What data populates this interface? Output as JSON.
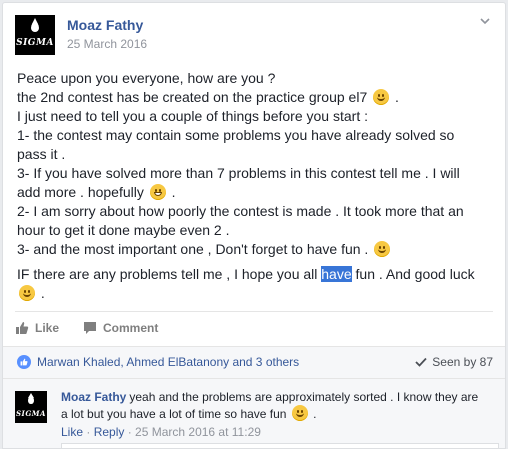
{
  "post": {
    "author": "Moaz Fathy",
    "date": "25 March 2016",
    "avatar_text": "SIGMA",
    "lines": [
      "Peace upon you everyone, how are you ?",
      "the 2nd contest has be created on the practice group el7",
      "I just need to tell you a couple of things before you start :",
      "1- the contest may contain some problems you have already solved so",
      "pass it .",
      "3- If you have solved more than 7 problems in this contest tell me . I will",
      "add more . hopefully",
      "2- I am sorry about how poorly the contest is made . It took more that an",
      "hour to get it done maybe even 2 .",
      "3- and the most important one , Don't forget to have fun ."
    ],
    "closing_before": "IF there are any problems tell me , I hope you all ",
    "closing_highlight": "have",
    "closing_after": " fun . And good luck"
  },
  "actions": {
    "like": "Like",
    "comment": "Comment"
  },
  "reactions": {
    "likers": "Marwan Khaled, Ahmed ElBatanony and 3 others",
    "seen": "Seen by 87"
  },
  "comment": {
    "author": "Moaz Fathy",
    "text": "yeah and the problems are approximately sorted . I know they are a lot but you have a lot of time so have fun",
    "like": "Like",
    "sep1": " · ",
    "reply": "Reply",
    "sep2": " · ",
    "time": "25 March 2016 at 11:29"
  },
  "colors": {
    "link": "#365899",
    "meta": "#90949c",
    "highlight": "#3875d7",
    "like_blue": "#5890ff"
  }
}
